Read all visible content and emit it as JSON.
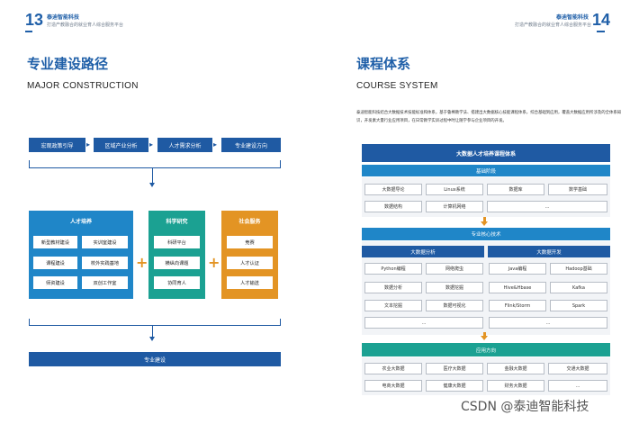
{
  "left": {
    "page_number": "13",
    "brand": "泰迪智能科技",
    "brand_sub": "打造产教融合的就业育人综合服务平台",
    "title": "专业建设路径",
    "subtitle": "MAJOR CONSTRUCTION",
    "flow": [
      "宏观政策引导",
      "区域产业分析",
      "人才需求分析",
      "专业建设方向"
    ],
    "groups": [
      {
        "title": "人才培养",
        "color": "#1f86c8",
        "items": [
          "新型教材建设",
          "实训室建设",
          "课程建设",
          "校外实践基地",
          "师资建设",
          "双创工作室"
        ]
      },
      {
        "title": "科学研究",
        "color": "#1ba192",
        "items": [
          "科研平台",
          "横纵向课题",
          "协同育人"
        ]
      },
      {
        "title": "社会服务",
        "color": "#e39424",
        "items": [
          "竞赛",
          "人才认证",
          "人才输送"
        ]
      }
    ],
    "bottom": "专业建设"
  },
  "right": {
    "page_number": "14",
    "brand": "泰迪智能科技",
    "brand_sub": "打造产教融合的就业育人综合服务平台",
    "title": "课程体系",
    "subtitle": "COURSE SYSTEM",
    "intro": "泰迪智能科技结合大数据技术技能标准和体系，基于鲁棒教学法、搭建出大数据核心技能课程体系，综合基础到应用，覆盖大数据应用所涉及的全体系知识，开发素大量行业应用项目，在日常教学实训过程中时让随学参与企业项目的开发。",
    "system_title": "大数据人才培养课程体系",
    "basic": {
      "title": "基础阶段",
      "row1": [
        "大数据导论",
        "Linux系统",
        "数据库",
        "数学基础"
      ],
      "row2": [
        "数据结构",
        "计算机网络",
        "..."
      ]
    },
    "core": {
      "title": "专业核心技术",
      "left_title": "大数据分析",
      "right_title": "大数据开发",
      "left_items": [
        "Python编程",
        "网络爬虫",
        "数据分析",
        "数据挖掘",
        "文本挖掘",
        "数据可视化",
        "..."
      ],
      "right_items": [
        "Java编程",
        "Hadoop基础",
        "Hive&Hbase",
        "Kafka",
        "Flink/Storm",
        "Spark",
        "..."
      ]
    },
    "apply": {
      "title": "应用方向",
      "row1": [
        "农业大数据",
        "医疗大数据",
        "金融大数据",
        "交通大数据"
      ],
      "row2": [
        "电商大数据",
        "健康大数据",
        "财务大数据",
        "..."
      ]
    }
  },
  "watermark": "CSDN @泰迪智能科技"
}
